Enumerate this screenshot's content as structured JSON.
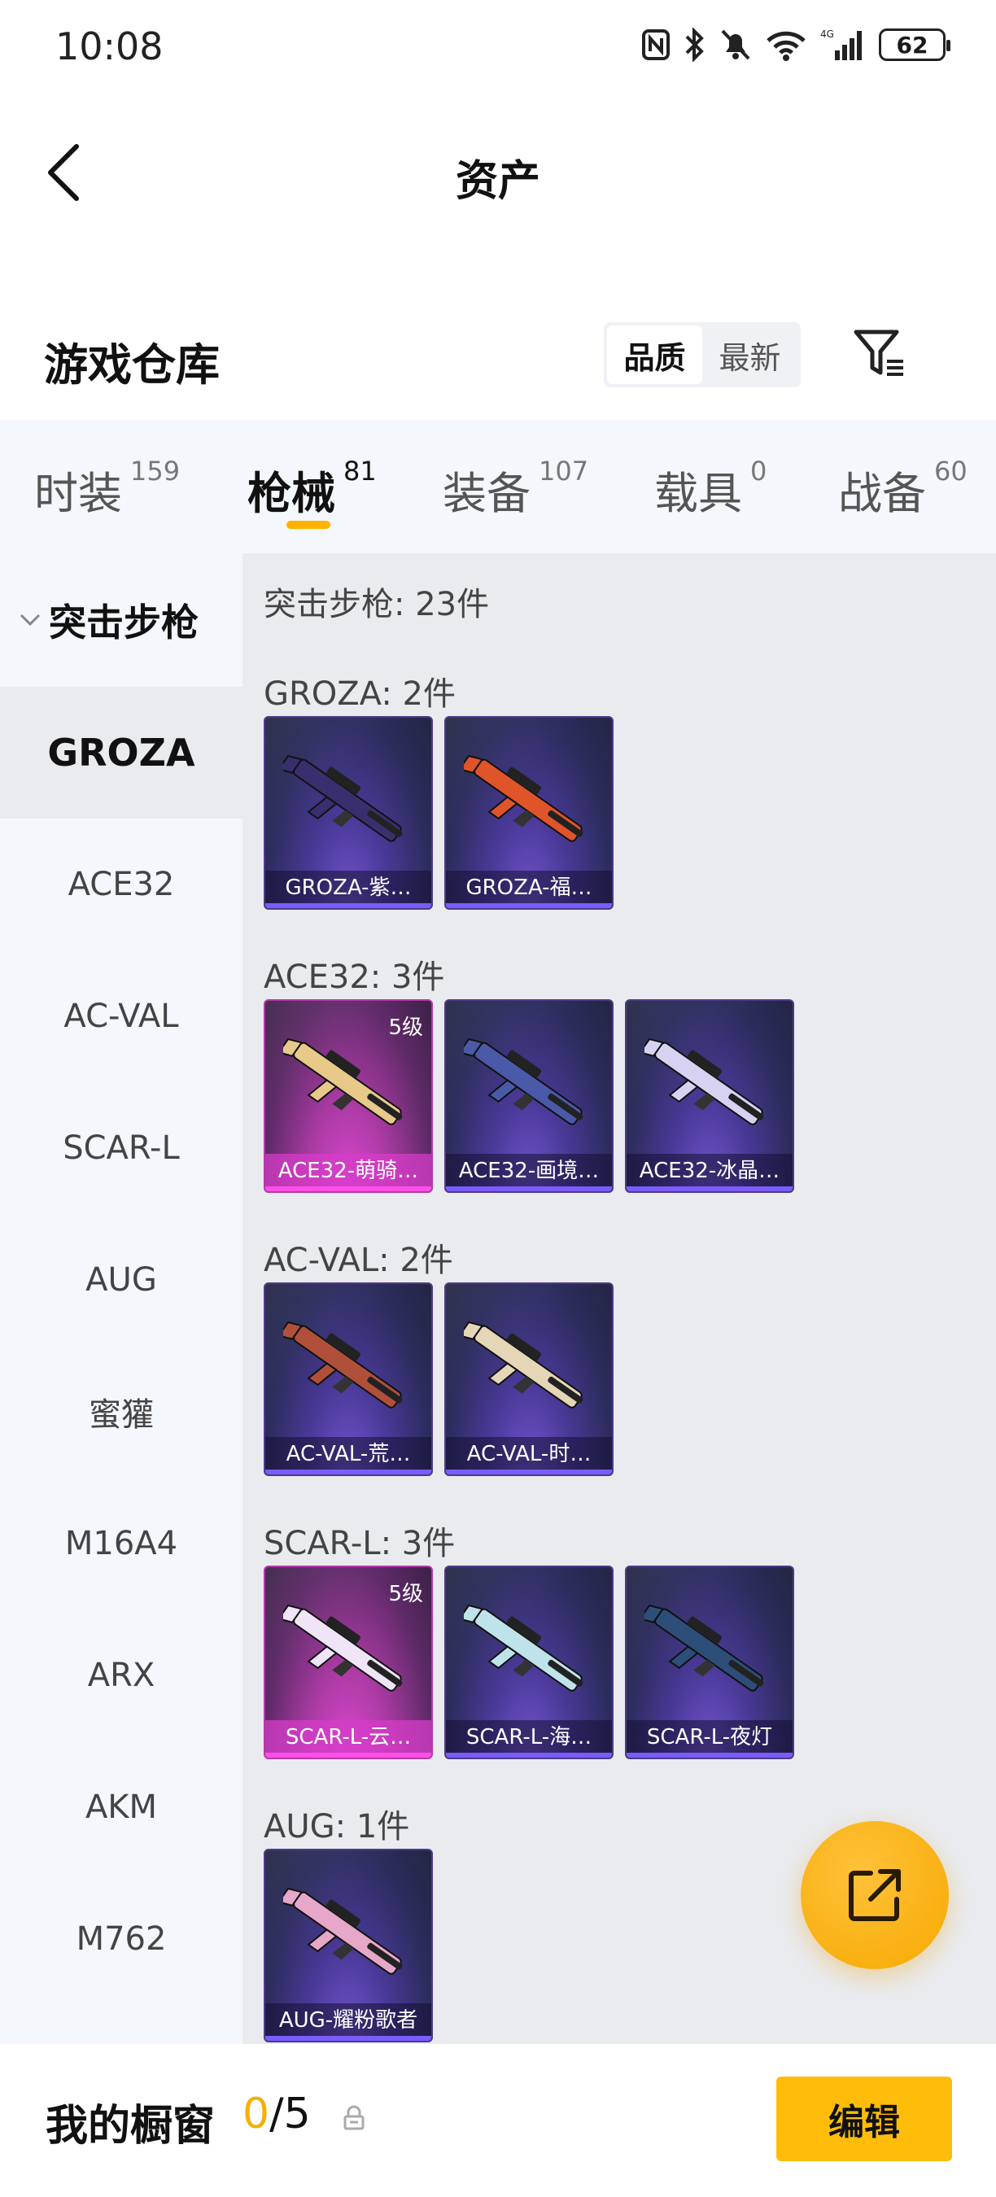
{
  "status": {
    "time": "10:08",
    "battery": "62",
    "network": "4G"
  },
  "header": {
    "title": "资产"
  },
  "warehouse": {
    "title": "游戏仓库",
    "sort": [
      "品质",
      "最新"
    ]
  },
  "tabs": [
    {
      "label": "时装",
      "count": "159"
    },
    {
      "label": "枪械",
      "count": "81"
    },
    {
      "label": "装备",
      "count": "107"
    },
    {
      "label": "载具",
      "count": "0"
    },
    {
      "label": "战备",
      "count": "60"
    }
  ],
  "sidebar": {
    "group": "突击步枪",
    "items": [
      "GROZA",
      "ACE32",
      "AC-VAL",
      "SCAR-L",
      "AUG",
      "蜜獾",
      "M16A4",
      "ARX",
      "AKM",
      "M762"
    ]
  },
  "content": {
    "summary": "突击步枪: 23件",
    "sections": [
      {
        "title": "GROZA: 2件",
        "items": [
          {
            "name": "GROZA-紫…",
            "rarity": "purple",
            "gun_color": "#3a2f6e"
          },
          {
            "name": "GROZA-福…",
            "rarity": "purple",
            "gun_color": "#e0542a"
          }
        ]
      },
      {
        "title": "ACE32: 3件",
        "items": [
          {
            "name": "ACE32-萌骑…",
            "rarity": "pink",
            "level": "5级",
            "gun_color": "#e8c98a"
          },
          {
            "name": "ACE32-画境…",
            "rarity": "purple",
            "gun_color": "#4a5aa8"
          },
          {
            "name": "ACE32-冰晶…",
            "rarity": "purple",
            "gun_color": "#d7d2f2"
          }
        ]
      },
      {
        "title": "AC-VAL: 2件",
        "items": [
          {
            "name": "AC-VAL-荒…",
            "rarity": "purple",
            "gun_color": "#b0503a"
          },
          {
            "name": "AC-VAL-时…",
            "rarity": "purple",
            "gun_color": "#e6d6b8"
          }
        ]
      },
      {
        "title": "SCAR-L: 3件",
        "items": [
          {
            "name": "SCAR-L-云…",
            "rarity": "pink",
            "level": "5级",
            "gun_color": "#f0e4f7"
          },
          {
            "name": "SCAR-L-海…",
            "rarity": "purple",
            "gun_color": "#bfe3ea"
          },
          {
            "name": "SCAR-L-夜灯",
            "rarity": "purple",
            "gun_color": "#2d4e78"
          }
        ]
      },
      {
        "title": "AUG: 1件",
        "items": [
          {
            "name": "AUG-耀粉歌者",
            "rarity": "purple",
            "gun_color": "#e7a7c8"
          }
        ]
      }
    ]
  },
  "showcase": {
    "title": "我的橱窗",
    "current": "0",
    "total": "/5",
    "edit_label": "编辑"
  },
  "icons": {
    "back": "back-arrow-icon",
    "filter": "filter-icon",
    "share": "share-external-icon",
    "lock": "lock-icon"
  },
  "colors": {
    "accent": "#ffbd0a",
    "tab_indicator": "#ffb200",
    "pink_rarity": "#d63cc8",
    "purple_rarity": "#4a3998"
  }
}
